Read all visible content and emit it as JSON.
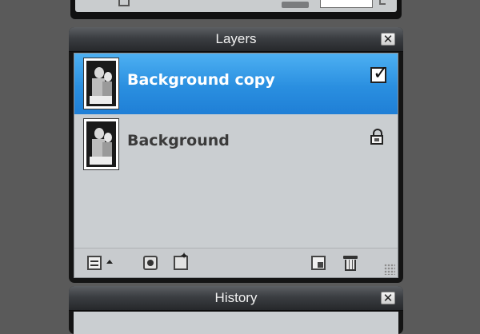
{
  "layers_panel": {
    "title": "Layers",
    "close_symbol": "✕",
    "layers": [
      {
        "name": "Background copy",
        "selected": true,
        "status_icon": "visibility-checkbox-icon",
        "status_glyph": "✓"
      },
      {
        "name": "Background",
        "selected": false,
        "status_icon": "lock-icon"
      }
    ],
    "toolbar": [
      "layer-properties-icon",
      "arrow-up-icon",
      "layer-mask-icon",
      "layer-effects-icon",
      "new-layer-icon",
      "delete-layer-icon",
      "resize-grip-icon"
    ]
  },
  "history_panel": {
    "title": "History",
    "close_symbol": "✕"
  },
  "colors": {
    "selection": "#2a8fe0",
    "panel_body": "#caced1",
    "background": "#5a5a5a"
  }
}
